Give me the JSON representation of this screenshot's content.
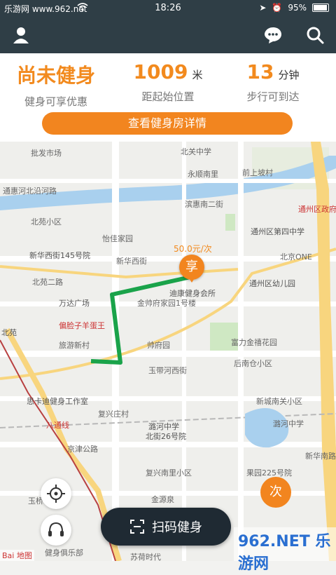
{
  "status_bar": {
    "carrier_label": "乐游网 www.962.net",
    "time": "18:26",
    "battery": "95%"
  },
  "app_bar": {
    "left_icon": "user-icon",
    "chat_icon": "chat-icon",
    "search_icon": "search-icon"
  },
  "info": {
    "status": {
      "value": "尚未健身",
      "caption": "健身可享优惠"
    },
    "distance": {
      "value": "1009",
      "unit": "米",
      "caption": "距起始位置"
    },
    "walk": {
      "value": "13",
      "unit": "分钟",
      "caption": "步行可到达"
    },
    "details_button": "查看健身房详情"
  },
  "map": {
    "price_label": "50.0元/次",
    "pin_icon_text": "享",
    "labels": [
      "批发市场",
      "北关中学",
      "永顺南里",
      "前上坡村",
      "通惠河北沿河路",
      "滨惠南二街",
      "通州区政府",
      "北苑小区",
      "怡佳家园",
      "通州区第四中学",
      "新华西街145号院",
      "新华西街",
      "北京ONE",
      "北苑二路",
      "迪康健身会所",
      "通州区幼儿园",
      "万达广场",
      "金帅府家园1号楼",
      "偏脸子羊蛋王",
      "帅府园",
      "旅游新村",
      "富力金禧花园",
      "北苑",
      "玉带河西街",
      "后南仓小区",
      "思卡迪健身工作室",
      "新城南关小区",
      "复兴庄村",
      "潞河中学",
      "北街26号院",
      "潞河中学",
      "八通线",
      "京津公路",
      "复兴南里小区",
      "果园225号院",
      "新华南路",
      "金源泉",
      "苏荷时代",
      "健身俱乐部",
      "玉桥北区"
    ],
    "next_button": "次",
    "scan_button": "扫码健身",
    "locate_icon": "crosshair-icon",
    "support_icon": "headset-icon",
    "watermark_left": "Bai 地图",
    "watermark_right": "962.NET 乐游网"
  }
}
